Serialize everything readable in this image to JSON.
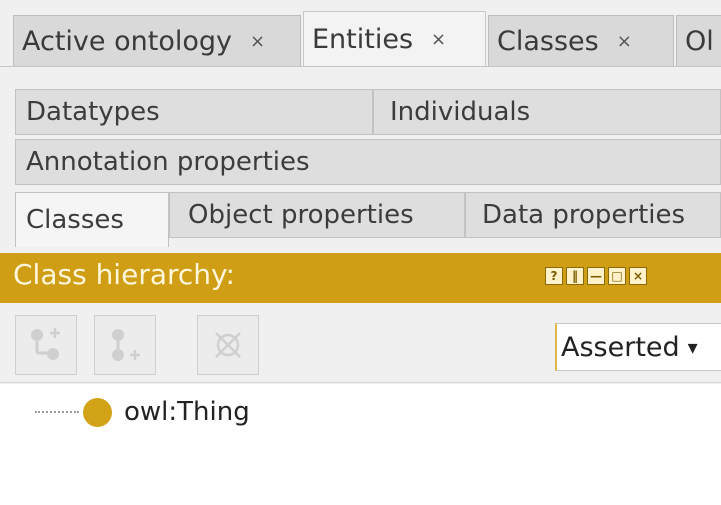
{
  "top_tabs": [
    {
      "label": "Active ontology",
      "close": "×"
    },
    {
      "label": "Entities",
      "close": "×"
    },
    {
      "label": "Classes",
      "close": "×"
    },
    {
      "label": "Ol"
    }
  ],
  "entity_tabs": {
    "row1": [
      "Datatypes",
      "Individuals"
    ],
    "row2": [
      "Annotation properties"
    ],
    "row3": [
      "Classes",
      "Object properties",
      "Data properties"
    ]
  },
  "class_hierarchy": {
    "title": "Class hierarchy:",
    "window_buttons": [
      "?",
      "‖",
      "—",
      "□",
      "×"
    ],
    "mode": "Asserted",
    "mode_arrow": "▾",
    "root": "owl:Thing"
  },
  "icons": {
    "add_subclass": "add-subclass-icon",
    "add_sibling": "add-sibling-class-icon",
    "delete": "delete-class-icon"
  },
  "colors": {
    "header": "#cf9e14",
    "thing_dot": "#d2a217"
  }
}
